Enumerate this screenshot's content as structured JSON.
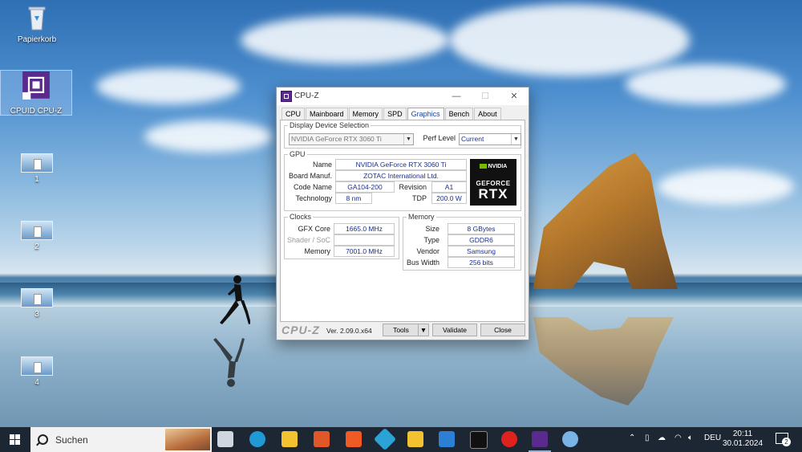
{
  "desktop": {
    "icons": [
      {
        "label": "Papierkorb",
        "icon": "recycle-bin-icon"
      },
      {
        "label": "CPUID CPU-Z",
        "icon": "cpu-z-icon"
      },
      {
        "label": "1",
        "icon": "image-file-icon"
      },
      {
        "label": "2",
        "icon": "image-file-icon"
      },
      {
        "label": "3",
        "icon": "image-file-icon"
      },
      {
        "label": "4",
        "icon": "image-file-icon"
      }
    ]
  },
  "window": {
    "title": "CPU-Z",
    "controls": {
      "minimize": "—",
      "maximize": "☐",
      "close": "✕"
    },
    "tabs": [
      "CPU",
      "Mainboard",
      "Memory",
      "SPD",
      "Graphics",
      "Bench",
      "About"
    ],
    "active_tab": "Graphics",
    "display_device": {
      "legend": "Display Device Selection",
      "selected_device": "NVIDIA GeForce RTX 3060 Ti",
      "perf_level_label": "Perf Level",
      "perf_level_value": "Current"
    },
    "gpu": {
      "legend": "GPU",
      "name_label": "Name",
      "name": "NVIDIA GeForce RTX 3060 Ti",
      "board_manuf_label": "Board Manuf.",
      "board_manuf": "ZOTAC International Ltd.",
      "code_name_label": "Code Name",
      "code_name": "GA104-200",
      "revision_label": "Revision",
      "revision": "A1",
      "technology_label": "Technology",
      "technology": "8 nm",
      "tdp_label": "TDP",
      "tdp": "200.0 W",
      "logo": {
        "brand": "NVIDIA",
        "line1": "GEFORCE",
        "line2": "RTX"
      }
    },
    "clocks": {
      "legend": "Clocks",
      "gfx_core_label": "GFX Core",
      "gfx_core": "1665.0 MHz",
      "shader_label": "Shader / SoC",
      "shader": "",
      "memory_label": "Memory",
      "memory": "7001.0 MHz"
    },
    "memory": {
      "legend": "Memory",
      "size_label": "Size",
      "size": "8 GBytes",
      "type_label": "Type",
      "type": "GDDR6",
      "vendor_label": "Vendor",
      "vendor": "Samsung",
      "bus_width_label": "Bus Width",
      "bus_width": "256 bits"
    },
    "footer": {
      "brand": "CPU-Z",
      "version": "Ver. 2.09.0.x64",
      "tools_label": "Tools",
      "validate_label": "Validate",
      "close_label": "Close"
    }
  },
  "taskbar": {
    "search_placeholder": "Suchen",
    "apps": [
      {
        "icon": "task-view-icon",
        "color": "#d0d6de"
      },
      {
        "icon": "edge-icon",
        "color": "#1f9ad6"
      },
      {
        "icon": "file-explorer-icon",
        "color": "#f2c230"
      },
      {
        "icon": "cube-app-icon",
        "color": "#e0572a"
      },
      {
        "icon": "brave-icon",
        "color": "#f05a24"
      },
      {
        "icon": "kodi-icon",
        "color": "#2ba3d6"
      },
      {
        "icon": "app-yellow-icon",
        "color": "#f2c230"
      },
      {
        "icon": "window-app-icon",
        "color": "#2d7fd6"
      },
      {
        "icon": "black-app-icon",
        "color": "#111111"
      },
      {
        "icon": "opera-icon",
        "color": "#e0221f"
      },
      {
        "icon": "cpu-z-taskbar-icon",
        "color": "#5b2a8f"
      },
      {
        "icon": "paint-icon",
        "color": "#7ab3e8"
      }
    ],
    "tray": {
      "language": "DEU",
      "time": "20:11",
      "date": "30.01.2024",
      "notification_count": "2"
    }
  }
}
